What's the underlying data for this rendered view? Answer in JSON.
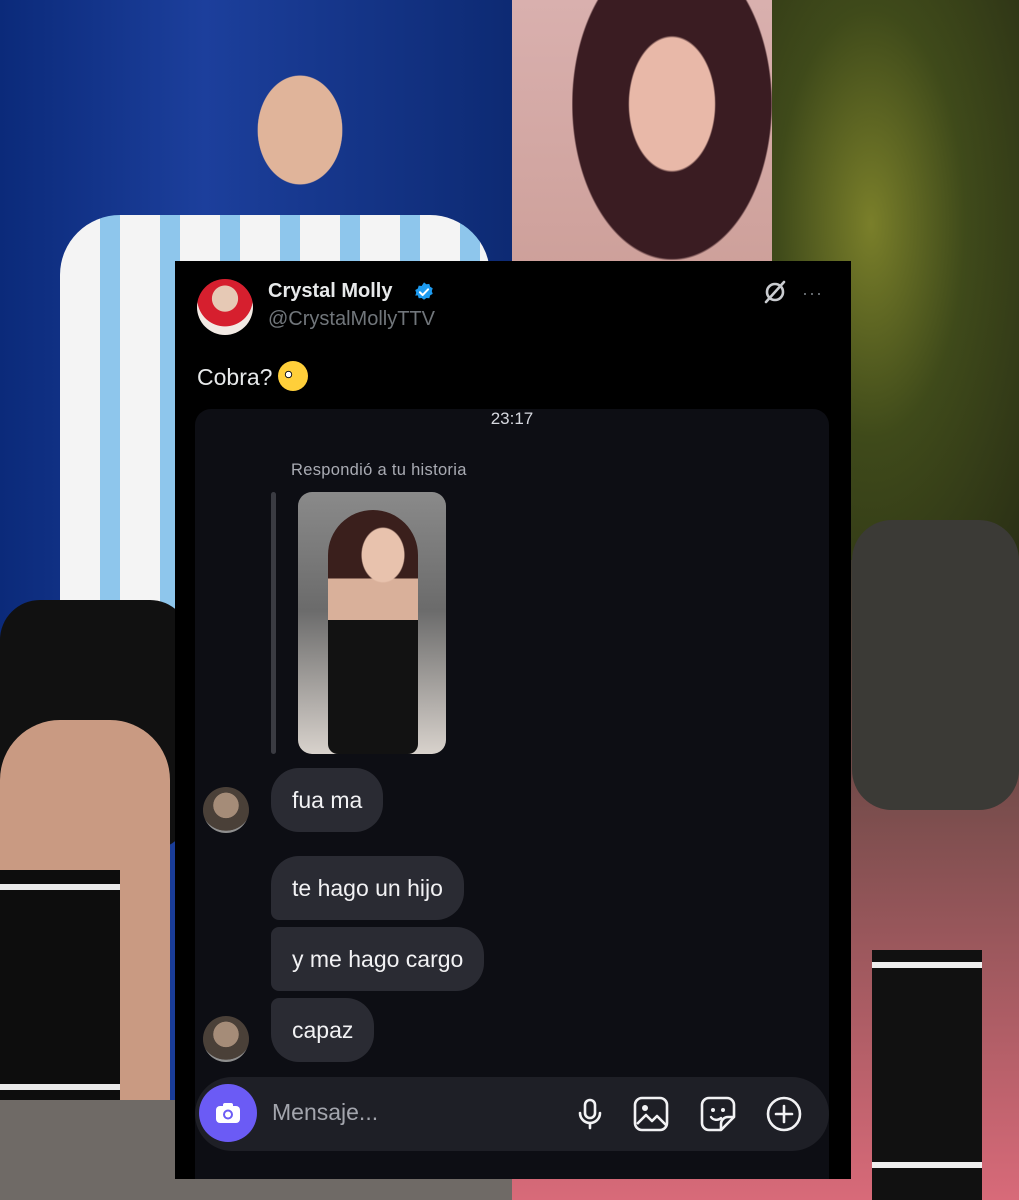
{
  "post": {
    "display_name": "Crystal Molly",
    "handle": "@CrystalMollyTTV",
    "text": "Cobra?",
    "more_glyph": "···"
  },
  "dm": {
    "time": "23:17",
    "reply_label": "Respondió a tu historia",
    "messages": [
      "fua ma",
      "te hago un hijo",
      "y me hago cargo",
      "capaz"
    ],
    "composer_placeholder": "Mensaje..."
  },
  "colors": {
    "verified": "#1d9bf0",
    "camera_button": "#6b5bf5",
    "bubble": "#2a2b33"
  }
}
